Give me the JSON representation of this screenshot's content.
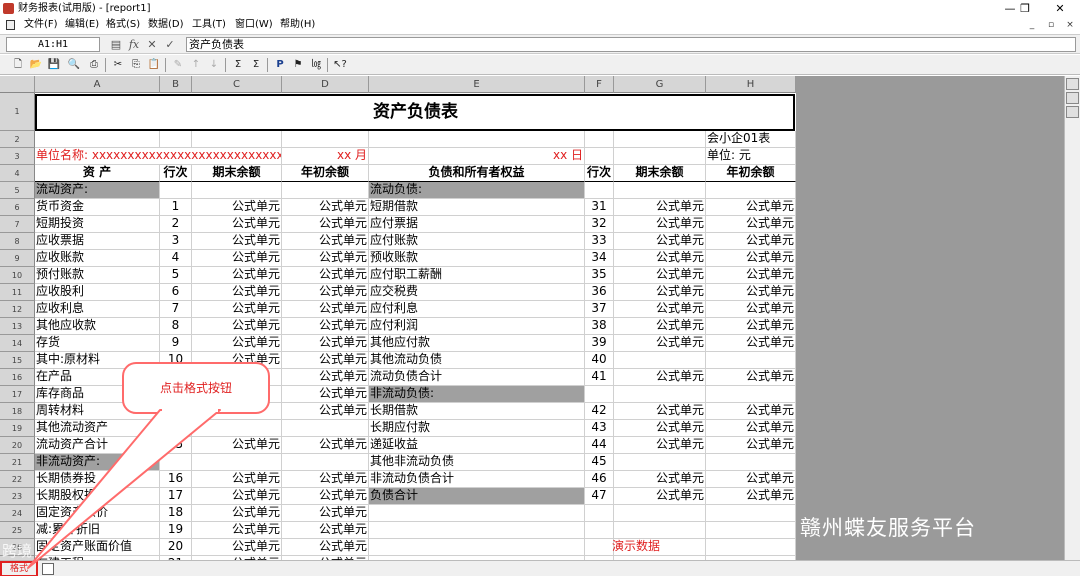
{
  "window": {
    "title": "财务报表(试用版) - [report1]",
    "min": "—",
    "max": "❐",
    "close": "✕",
    "child_min": "_",
    "child_restore": "▫",
    "child_close": "×"
  },
  "menu": [
    "文件(F)",
    "编辑(E)",
    "格式(S)",
    "数据(D)",
    "工具(T)",
    "窗口(W)",
    "帮助(H)"
  ],
  "formula_bar": {
    "cell_ref": "A1:H1",
    "content": "资产负债表"
  },
  "sheet": {
    "columns": [
      "A",
      "B",
      "C",
      "D",
      "E",
      "F",
      "G",
      "H"
    ],
    "row_numbers": [
      "1",
      "2",
      "3",
      "4",
      "5",
      "6",
      "7",
      "8",
      "9",
      "10",
      "11",
      "12",
      "13",
      "14",
      "15",
      "16",
      "17",
      "18",
      "19",
      "20",
      "21",
      "22",
      "23",
      "24",
      "25",
      "26",
      "27"
    ],
    "title": "资产负债表",
    "row2_h": "会小企01表",
    "row3": {
      "a": "单位名称: xxxxxxxxxxxxxxxxxxxxxxxxxxxxxxxx年",
      "d": "xx 月",
      "e": "xx 日",
      "h": "单位: 元"
    },
    "header": {
      "a": "资    产",
      "b": "行次",
      "c": "期末余额",
      "d": "年初余额",
      "e": "负债和所有者权益",
      "f": "行次",
      "g": "期末余额",
      "h": "年初余额"
    },
    "rows": [
      {
        "a": "流动资产:",
        "b": "",
        "c": "",
        "d": "",
        "e": "流动负债:",
        "f": "",
        "g": "",
        "h": "",
        "agrey": true,
        "egrey": true
      },
      {
        "a": "   货币资金",
        "b": "1",
        "c": "公式单元",
        "d": "公式单元",
        "e": "   短期借款",
        "f": "31",
        "g": "公式单元",
        "h": "公式单元"
      },
      {
        "a": "   短期投资",
        "b": "2",
        "c": "公式单元",
        "d": "公式单元",
        "e": "   应付票据",
        "f": "32",
        "g": "公式单元",
        "h": "公式单元"
      },
      {
        "a": "   应收票据",
        "b": "3",
        "c": "公式单元",
        "d": "公式单元",
        "e": "   应付账款",
        "f": "33",
        "g": "公式单元",
        "h": "公式单元"
      },
      {
        "a": "   应收账款",
        "b": "4",
        "c": "公式单元",
        "d": "公式单元",
        "e": "   预收账款",
        "f": "34",
        "g": "公式单元",
        "h": "公式单元"
      },
      {
        "a": "   预付账款",
        "b": "5",
        "c": "公式单元",
        "d": "公式单元",
        "e": "   应付职工薪酬",
        "f": "35",
        "g": "公式单元",
        "h": "公式单元"
      },
      {
        "a": "   应收股利",
        "b": "6",
        "c": "公式单元",
        "d": "公式单元",
        "e": "   应交税费",
        "f": "36",
        "g": "公式单元",
        "h": "公式单元"
      },
      {
        "a": "   应收利息",
        "b": "7",
        "c": "公式单元",
        "d": "公式单元",
        "e": "   应付利息",
        "f": "37",
        "g": "公式单元",
        "h": "公式单元"
      },
      {
        "a": "   其他应收款",
        "b": "8",
        "c": "公式单元",
        "d": "公式单元",
        "e": "   应付利润",
        "f": "38",
        "g": "公式单元",
        "h": "公式单元"
      },
      {
        "a": "   存货",
        "b": "9",
        "c": "公式单元",
        "d": "公式单元",
        "e": "   其他应付款",
        "f": "39",
        "g": "公式单元",
        "h": "公式单元"
      },
      {
        "a": "其中:原材料",
        "b": "10",
        "c": "公式单元",
        "d": "公式单元",
        "e": "   其他流动负债",
        "f": "40",
        "g": "",
        "h": ""
      },
      {
        "a": "      在产品",
        "b": "",
        "c": "",
        "d": "公式单元",
        "e": "   流动负债合计",
        "f": "41",
        "g": "公式单元",
        "h": "公式单元"
      },
      {
        "a": "      库存商品",
        "b": "",
        "c": "",
        "d": "公式单元",
        "e": "非流动负债:",
        "f": "",
        "g": "",
        "h": "",
        "egrey": true
      },
      {
        "a": "      周转材料",
        "b": "",
        "c": "",
        "d": "公式单元",
        "e": "   长期借款",
        "f": "42",
        "g": "公式单元",
        "h": "公式单元"
      },
      {
        "a": "   其他流动资产",
        "b": "",
        "c": "",
        "d": "",
        "e": "   长期应付款",
        "f": "43",
        "g": "公式单元",
        "h": "公式单元"
      },
      {
        "a": "   流动资产合计",
        "b": "15",
        "c": "公式单元",
        "d": "公式单元",
        "e": "   递延收益",
        "f": "44",
        "g": "公式单元",
        "h": "公式单元"
      },
      {
        "a": "非流动资产:",
        "b": "",
        "c": "",
        "d": "",
        "e": "   其他非流动负债",
        "f": "45",
        "g": "",
        "h": "",
        "agrey": true
      },
      {
        "a": "   长期债券投",
        "b": "16",
        "c": "公式单元",
        "d": "公式单元",
        "e": "   非流动负债合计",
        "f": "46",
        "g": "公式单元",
        "h": "公式单元"
      },
      {
        "a": "   长期股权投资",
        "b": "17",
        "c": "公式单元",
        "d": "公式单元",
        "e": "负债合计",
        "f": "47",
        "g": "公式单元",
        "h": "公式单元",
        "egrey": true
      },
      {
        "a": "   固定资产原价",
        "b": "18",
        "c": "公式单元",
        "d": "公式单元",
        "e": "",
        "f": "",
        "g": "",
        "h": ""
      },
      {
        "a": "   减:累计折旧",
        "b": "19",
        "c": "公式单元",
        "d": "公式单元",
        "e": "",
        "f": "",
        "g": "",
        "h": ""
      },
      {
        "a": "   固定资产账面价值",
        "b": "20",
        "c": "公式单元",
        "d": "公式单元",
        "e": "",
        "f": "",
        "g": "",
        "h": ""
      },
      {
        "a": "   在建工程",
        "b": "21",
        "c": "公式单元",
        "d": "公式单元",
        "e": "",
        "f": "",
        "g": "",
        "h": ""
      }
    ]
  },
  "callout": {
    "text": "点击格式按钮"
  },
  "demo_text": "演示数据",
  "status": {
    "format_button": "格式"
  },
  "watermarks": {
    "right": "赣州蝶友服务平台",
    "left": "跨境"
  },
  "colors": {
    "grey_fill": "#a0a0a0",
    "red": "#e02020",
    "app_bg": "#9a9a9a"
  }
}
